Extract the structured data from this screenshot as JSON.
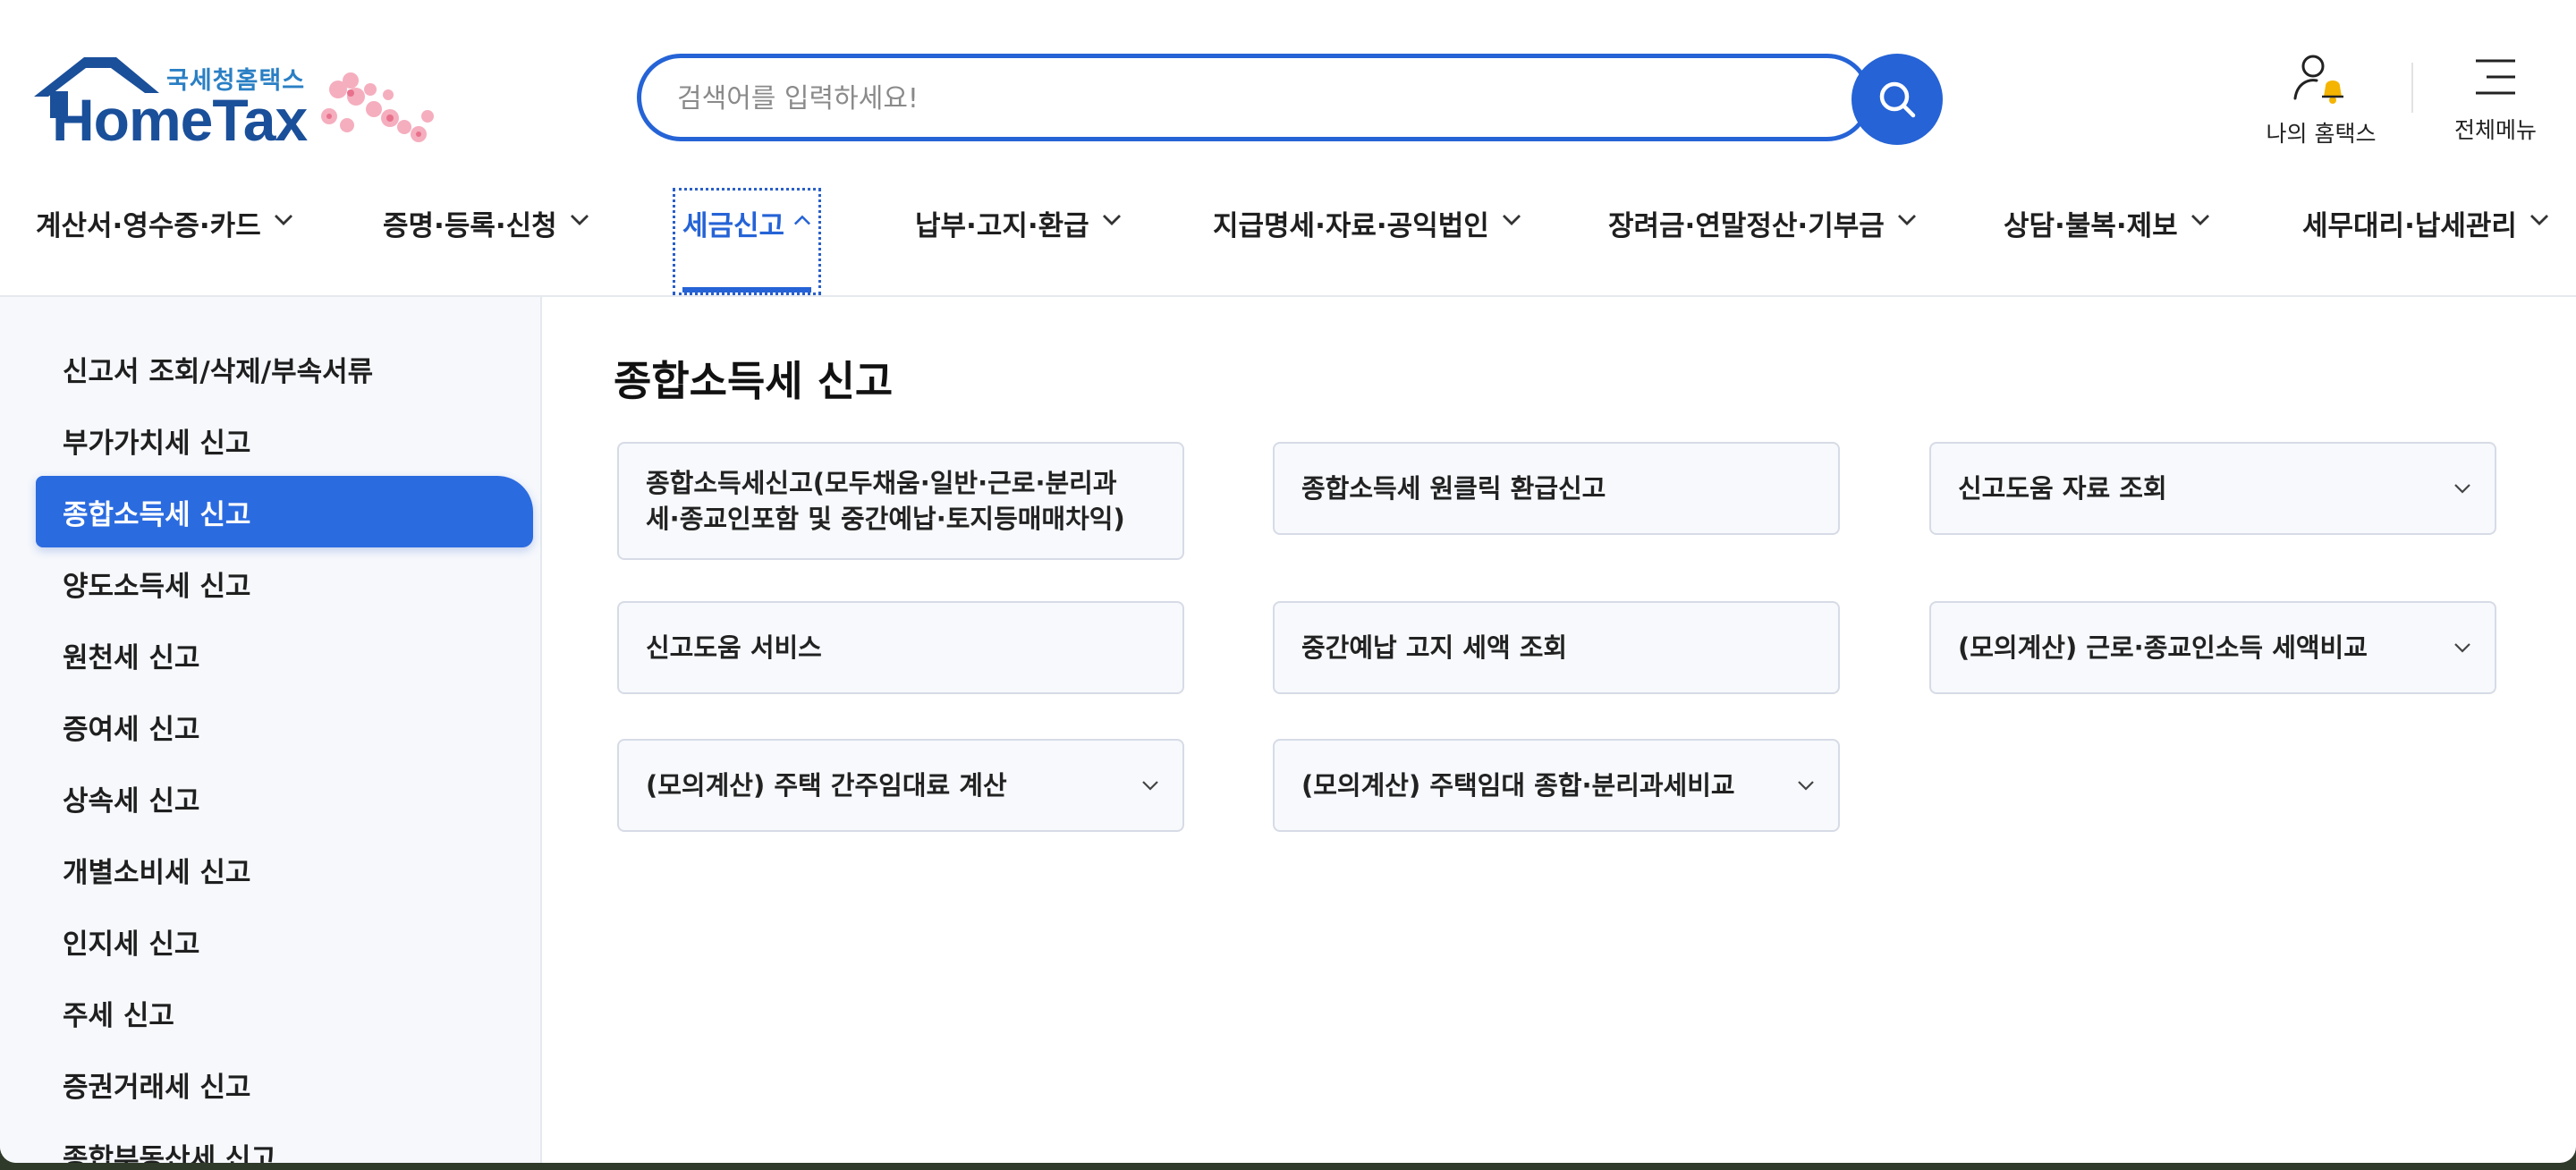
{
  "header": {
    "logo_ko": "국세청홈택스",
    "logo_en": "HomeTax",
    "search_placeholder": "검색어를 입력하세요!",
    "my_hometax": "나의 홈택스",
    "all_menu": "전체메뉴"
  },
  "gnb": [
    {
      "label": "계산서·영수증·카드",
      "active": false
    },
    {
      "label": "증명·등록·신청",
      "active": false
    },
    {
      "label": "세금신고",
      "active": true
    },
    {
      "label": "납부·고지·환급",
      "active": false
    },
    {
      "label": "지급명세·자료·공익법인",
      "active": false
    },
    {
      "label": "장려금·연말정산·기부금",
      "active": false
    },
    {
      "label": "상담·불복·제보",
      "active": false
    },
    {
      "label": "세무대리·납세관리",
      "active": false
    }
  ],
  "sidebar": {
    "items": [
      {
        "label": "신고서 조회/삭제/부속서류"
      },
      {
        "label": "부가가치세 신고"
      },
      {
        "label": "종합소득세 신고",
        "active": true
      },
      {
        "label": "양도소득세 신고"
      },
      {
        "label": "원천세 신고"
      },
      {
        "label": "증여세 신고"
      },
      {
        "label": "상속세 신고"
      },
      {
        "label": "개별소비세 신고"
      },
      {
        "label": "인지세 신고"
      },
      {
        "label": "주세 신고"
      },
      {
        "label": "증권거래세 신고"
      },
      {
        "label": "종합부동산세 신고"
      }
    ]
  },
  "main": {
    "title": "종합소득세 신고",
    "cards": [
      {
        "label": "종합소득세신고(모두채움·일반·근로·분리과세·종교인포함 및 중간예납·토지등매매차익)",
        "dropdown": false
      },
      {
        "label": "종합소득세 원클릭 환급신고",
        "dropdown": false
      },
      {
        "label": "신고도움 자료 조회",
        "dropdown": true
      },
      {
        "label": "신고도움 서비스",
        "dropdown": false
      },
      {
        "label": "중간예납 고지 세액 조회",
        "dropdown": false
      },
      {
        "label": "(모의계산) 근로·종교인소득 세액비교",
        "dropdown": true
      },
      {
        "label": "(모의계산) 주택 간주임대료 계산",
        "dropdown": true
      },
      {
        "label": "(모의계산) 주택임대 종합·분리과세비교",
        "dropdown": true
      }
    ]
  },
  "colors": {
    "accent": "#2563d6",
    "sidebar_bg": "#f6f8fc",
    "card_bg": "#f7f9fc"
  }
}
